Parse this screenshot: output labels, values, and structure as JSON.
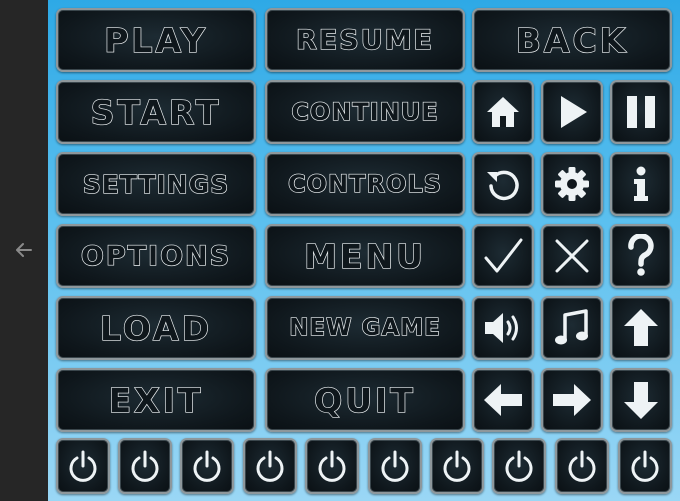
{
  "viewer": {
    "back_icon": "arrow-left-icon"
  },
  "colors": {
    "background_top": "#2ea9e6",
    "background_bottom": "#9ad7f5",
    "button_fill": "#0f171c",
    "button_border": "#8e979b",
    "glyph": "#eef3f5"
  },
  "text_buttons": {
    "play": "PLAY",
    "resume": "RESUME",
    "back": "BACK",
    "start": "START",
    "continue": "CONTINUE",
    "settings": "SETTINGS",
    "controls": "CONTROLS",
    "options": "OPTIONS",
    "menu": "MENU",
    "load": "LOAD",
    "new_game": "NEW GAME",
    "exit": "EXIT",
    "quit": "QUIT"
  },
  "icon_buttons": [
    "home-icon",
    "play-icon",
    "pause-icon",
    "restart-icon",
    "gear-icon",
    "info-icon",
    "checkmark-icon",
    "close-icon",
    "question-icon",
    "volume-icon",
    "music-icon",
    "arrow-up-icon",
    "arrow-left-icon",
    "arrow-right-icon",
    "arrow-down-icon"
  ],
  "power_buttons": {
    "icon": "power-icon",
    "count": 10
  }
}
